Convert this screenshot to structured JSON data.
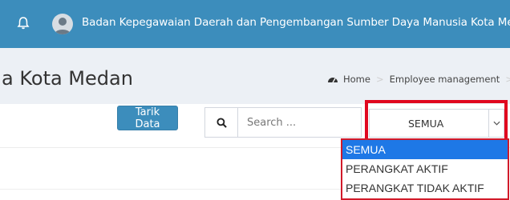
{
  "topbar": {
    "bell_icon": "bell-icon",
    "avatar_icon": "user-avatar-icon",
    "title": "Badan Kepegawaian Daerah dan Pengembangan Sumber Daya Manusia Kota Medan"
  },
  "header": {
    "title": "a Kota Medan",
    "breadcrumb": {
      "home": "Home",
      "current": "Employee management"
    }
  },
  "toolbar": {
    "tarik_data_label": "Tarik Data",
    "search_placeholder": "Search ..."
  },
  "filter": {
    "selected": "SEMUA",
    "options": [
      "SEMUA",
      "PERANGKAT AKTIF",
      "PERANGKAT TIDAK AKTIF"
    ]
  },
  "colors": {
    "brand": "#3c8dbc",
    "highlight": "#e0061f",
    "selected_option": "#1e78e6"
  }
}
